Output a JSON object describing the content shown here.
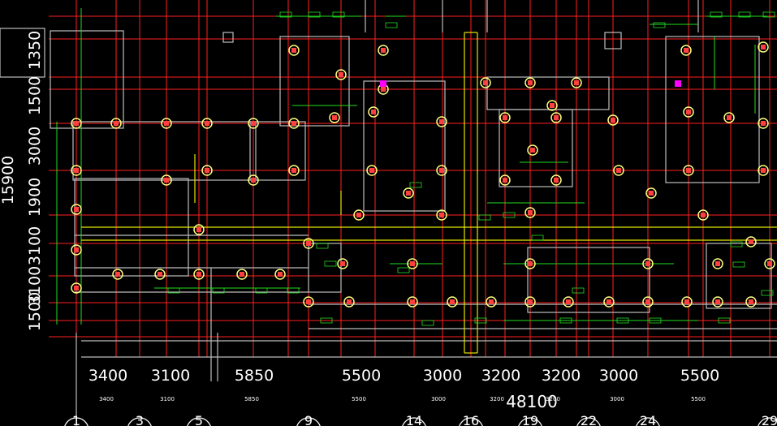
{
  "drawing": {
    "overall_span": "48100",
    "left_total": "15900",
    "bottom_spans": [
      "3400",
      "3100",
      "5850",
      "5500",
      "3000",
      "3200",
      "3200",
      "3000",
      "5500"
    ],
    "bottom_spans_small": [
      "3400",
      "3100",
      "5850",
      "5500",
      "3000",
      "3200",
      "3200",
      "3000",
      "5500"
    ],
    "left_dims": [
      "1500",
      "3100",
      "3100",
      "1900",
      "3000",
      "1500",
      "1350"
    ],
    "axis_labels": [
      "1",
      "3",
      "5",
      "9",
      "14",
      "16",
      "19",
      "22",
      "24",
      "29"
    ],
    "colors": {
      "background": "#000000",
      "axis_line": "#ff0000",
      "wall": "#c0c0c0",
      "column": "#ffff80",
      "dim_line": "#00ff00",
      "text": "#ffffff",
      "highlight": "#ffff00",
      "marker": "#ff00ff"
    }
  }
}
